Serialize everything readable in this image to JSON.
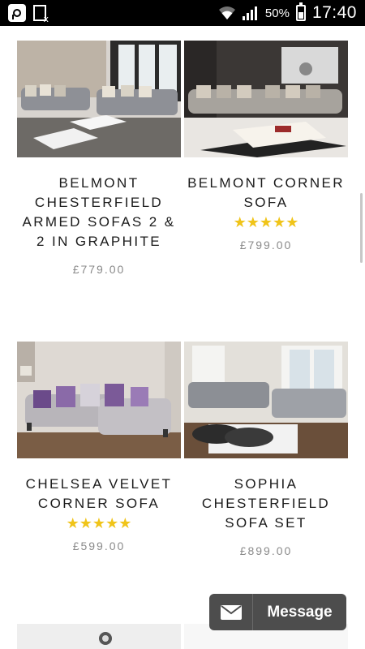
{
  "status_bar": {
    "battery_percent": "50%",
    "time": "17:40",
    "icons": [
      "app-icon",
      "document-icon",
      "wifi-icon",
      "signal-icon",
      "battery-icon"
    ]
  },
  "products": [
    {
      "name": "BELMONT CHESTERFIELD ARMED SOFAS 2 & 2 IN GRAPHITE",
      "rating": "",
      "price": "£779.00"
    },
    {
      "name": "BELMONT CORNER SOFA",
      "rating": "★★★★★",
      "price": "£799.00"
    },
    {
      "name": "CHELSEA VELVET CORNER SOFA",
      "rating": "★★★★★",
      "price": "£599.00"
    },
    {
      "name": "SOPHIA CHESTERFIELD SOFA SET",
      "rating": "",
      "price": "£899.00"
    }
  ],
  "message_button": {
    "label": "Message",
    "icon": "envelope-icon"
  },
  "colors": {
    "star": "#f0c419",
    "price": "#8a8a8a",
    "message_bg": "#4d4d4d"
  }
}
